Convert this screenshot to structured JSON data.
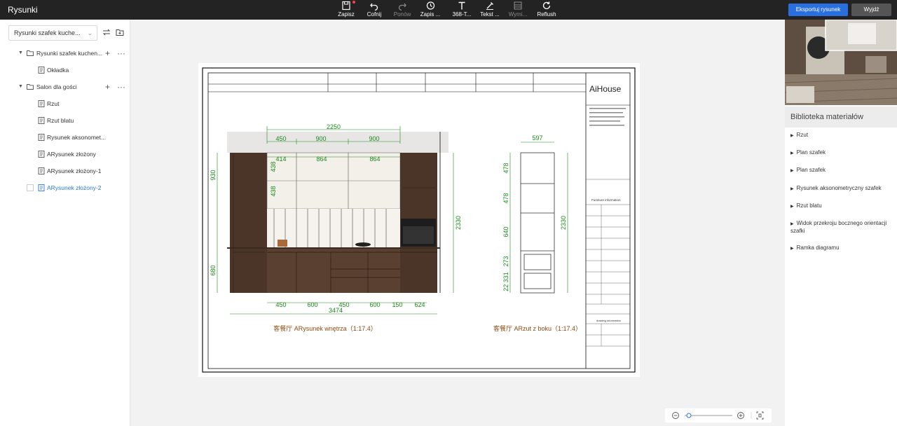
{
  "app": {
    "title": "Rysunki"
  },
  "toolbar": {
    "save": "Zapisz",
    "undo": "Cofnij",
    "redo": "Ponów",
    "history": "Zapis ...",
    "text3d": "368-T...",
    "text": "Tekst ...",
    "dims": "Wymi...",
    "reflush": "Reflush",
    "export": "Eksportuj rysunek",
    "exit": "Wyjdź"
  },
  "sidebar": {
    "select_value": "Rysunki szafek kuche...",
    "tree": [
      {
        "label": "Rysunki szafek kuchen..."
      },
      {
        "label": "Okładka"
      },
      {
        "label": "Salon dla gości"
      },
      {
        "label": "Rzut"
      },
      {
        "label": "Rzut blatu"
      },
      {
        "label": "Rysunek aksonomet..."
      },
      {
        "label": "ARysunek złożony"
      },
      {
        "label": "ARysunek złożony-1"
      },
      {
        "label": "ARysunek złożony-2"
      }
    ]
  },
  "drawing": {
    "brand": "AiHouse",
    "front_caption": "客餐厅 ARysunek wnętrza（1:17.4）",
    "side_caption": "客餐厅 ARzut z boku（1:17.4）",
    "dims_front": {
      "total_top": "2250",
      "top_segs": [
        "450",
        "900",
        "900"
      ],
      "inner_top": [
        "414",
        "864",
        "864"
      ],
      "bottom_segs": [
        "450",
        "600",
        "450",
        "600",
        "150",
        "624"
      ],
      "bottom_total": "3474",
      "left_v": [
        "930",
        "438",
        "438",
        "680"
      ],
      "right_v": [
        "2330"
      ]
    },
    "dims_side": {
      "top": "597",
      "left_v": [
        "478",
        "478",
        "640",
        "273",
        "22 331"
      ],
      "right_v": "2330"
    },
    "info": {
      "header": "Furniture information",
      "drawing_info": "drawing information"
    }
  },
  "library": {
    "title": "Biblioteka materiałów",
    "items": [
      "Rzut",
      "Plan szafek",
      "Plan szafek",
      "Rysunek aksonometryczny szafek",
      "Rzut blatu",
      "Widok przekroju bocznego orientacji szafki",
      "Ramka diagramu"
    ]
  },
  "colors": {
    "topbar": "#232323",
    "accent": "#2a6fe0",
    "dim_green": "#1a8a1a",
    "wood": "#4a3528",
    "active_blue": "#2a7ad5"
  }
}
